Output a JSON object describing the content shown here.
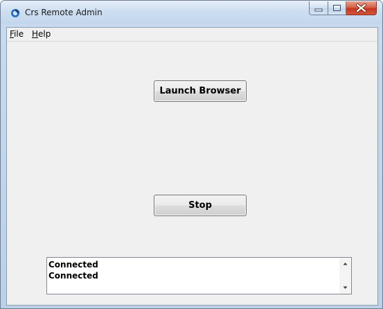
{
  "window": {
    "title": "Crs Remote Admin",
    "controls": [
      "minimize-icon",
      "maximize-icon",
      "close-icon"
    ]
  },
  "menu": {
    "file": {
      "accel": "F",
      "rest": "ile"
    },
    "help": {
      "accel": "H",
      "rest": "elp"
    }
  },
  "buttons": {
    "launch": "Launch Browser",
    "stop": "Stop"
  },
  "log": {
    "lines": [
      "Connected",
      "Connected"
    ]
  }
}
